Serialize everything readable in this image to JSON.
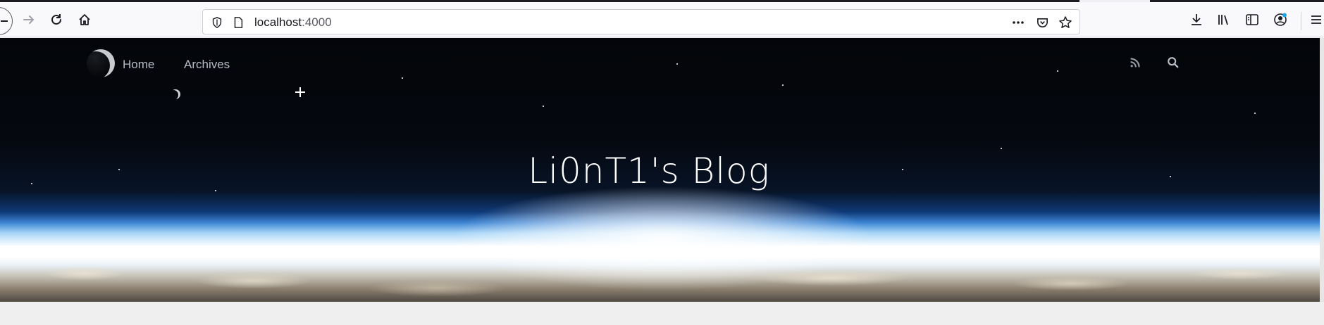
{
  "browser": {
    "url_host": "localhost",
    "url_port": ":4000",
    "icons": {
      "back": "back-arrow-icon",
      "forward": "forward-arrow-icon",
      "reload": "reload-icon",
      "home": "home-icon",
      "shield": "tracking-protection-shield-icon",
      "page": "page-info-icon",
      "more": "more-dots-icon",
      "pocket": "pocket-icon",
      "bookmark": "star-bookmark-icon",
      "downloads": "download-icon",
      "library": "library-icon",
      "sidebar": "sidebar-icon",
      "account": "account-icon",
      "menu": "hamburger-menu-icon"
    }
  },
  "site": {
    "nav": {
      "home": "Home",
      "archives": "Archives"
    },
    "title": "Li0nT1's Blog",
    "icons": {
      "rss": "rss-icon",
      "search": "search-icon"
    }
  },
  "colors": {
    "hero_top": "#030509",
    "horizon_blue": "#3c84d3",
    "nav_text": "#b8bcc4",
    "title_text": "#ffffff",
    "page_bg": "#efefef"
  }
}
